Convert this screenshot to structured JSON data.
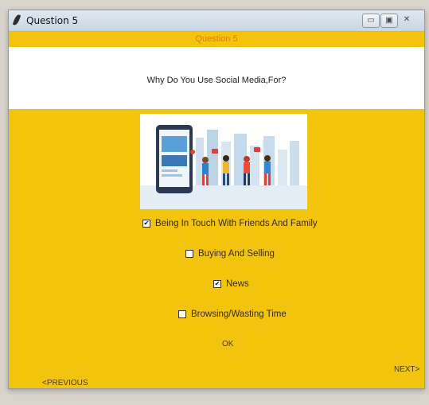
{
  "window": {
    "title": "Question 5",
    "controls": {
      "minimize": "▭",
      "maximize": "▣",
      "close": "✕"
    }
  },
  "banner": {
    "text": "Question 5"
  },
  "question": {
    "text": "Why Do You Use Social Media,For?"
  },
  "options": [
    {
      "label": "Being In Touch With Friends And Family",
      "checked": true
    },
    {
      "label": "Buying And Selling",
      "checked": false
    },
    {
      "label": "News",
      "checked": true
    },
    {
      "label": "Browsing/Wasting Time",
      "checked": false
    }
  ],
  "buttons": {
    "ok": "OK",
    "previous": "<PREVIOUS",
    "next": "NEXT>"
  },
  "colors": {
    "window_bg": "#f2c40d",
    "banner_text": "#e07a12",
    "panel": "#ffffff"
  },
  "checkmark": "✔"
}
